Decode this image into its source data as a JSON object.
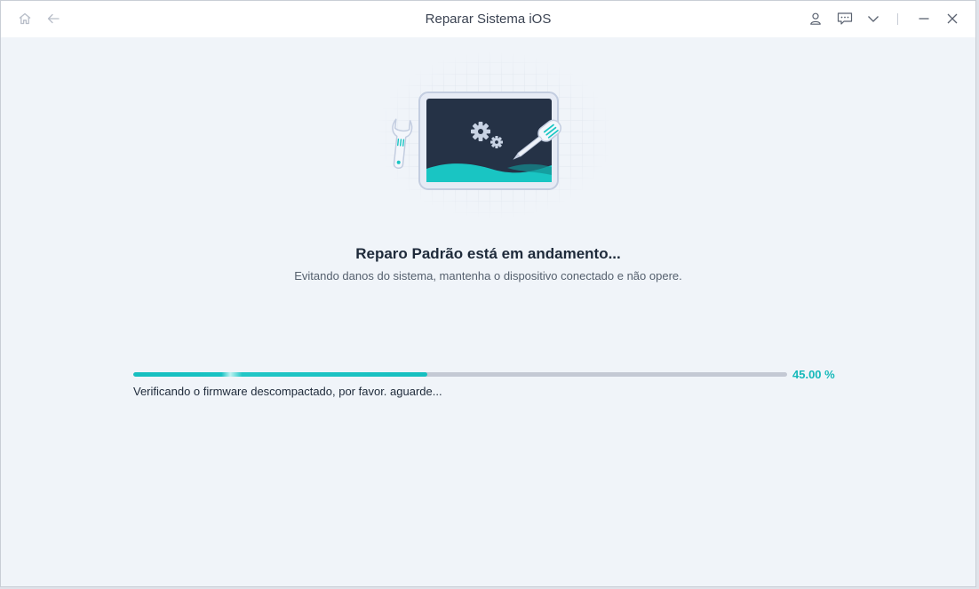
{
  "window": {
    "title": "Reparar Sistema iOS"
  },
  "titlebar": {
    "icons": [
      "home-icon",
      "back-arrow-icon",
      "user-icon",
      "feedback-icon",
      "chevron-down-icon",
      "minimize-icon",
      "close-icon"
    ]
  },
  "main": {
    "heading": "Reparo Padrão está em andamento...",
    "subheading": "Evitando danos do sistema, mantenha o dispositivo conectado e não opere."
  },
  "progress": {
    "percent": 45,
    "percent_label": "45.00 %",
    "status": "Verificando o firmware descompactado, por favor. aguarde..."
  },
  "colors": {
    "accent": "#17bfc0",
    "background": "#f0f4f9",
    "track": "#c4c9d4",
    "text_dark": "#1e2a3a"
  }
}
